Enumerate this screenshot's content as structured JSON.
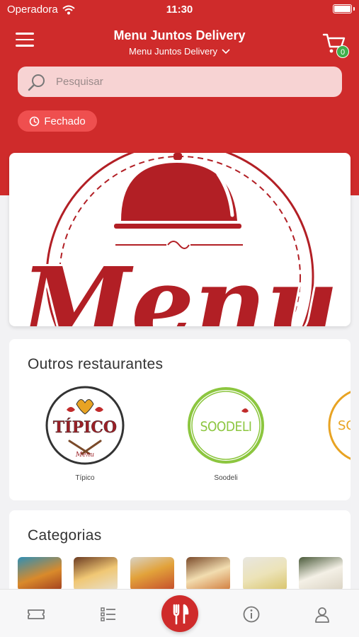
{
  "status_bar": {
    "carrier": "Operadora",
    "time": "11:30"
  },
  "header": {
    "title": "Menu Juntos Delivery",
    "subtitle": "Menu Juntos Delivery",
    "cart_count": "0",
    "menu_icon": "hamburger-icon",
    "cart_icon": "cart-icon"
  },
  "search": {
    "placeholder": "Pesquisar",
    "value": ""
  },
  "store_status": {
    "label": "Fechado",
    "icon": "clock-icon"
  },
  "banner": {
    "logo_text": "Menu"
  },
  "other_restaurants": {
    "title": "Outros restaurantes",
    "items": [
      {
        "name": "Típico",
        "logo_text": "TÍPICO",
        "logo_sub": "Menu"
      },
      {
        "name": "Soodeli",
        "logo_text": "SOODELI"
      },
      {
        "name": "",
        "logo_text": "SO"
      }
    ]
  },
  "categories": {
    "title": "Categorias"
  },
  "tabbar": {
    "items": [
      "ticket-icon",
      "list-icon",
      "cutlery-icon",
      "info-icon",
      "user-icon"
    ]
  },
  "colors": {
    "brand": "#cf2b2b",
    "badge_green": "#3fae49",
    "closed": "#ef4f4f"
  }
}
